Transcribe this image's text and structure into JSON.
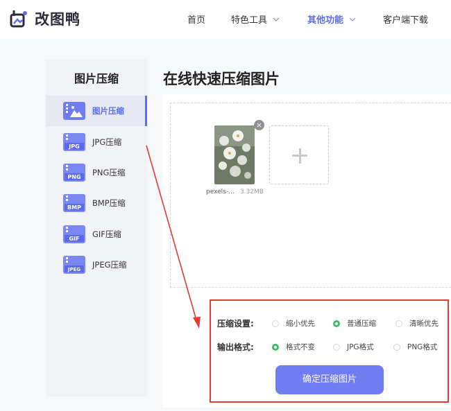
{
  "brand": {
    "name": "改图鸭",
    "color": "#5b6cf0"
  },
  "nav": [
    {
      "label": "首页",
      "dropdown": false,
      "active": false
    },
    {
      "label": "特色工具",
      "dropdown": true,
      "active": false
    },
    {
      "label": "其他功能",
      "dropdown": true,
      "active": true
    },
    {
      "label": "客户端下载",
      "dropdown": false,
      "active": false
    }
  ],
  "sidebar": {
    "title": "图片压缩",
    "items": [
      {
        "label": "图片压缩",
        "icon": "image-file-icon",
        "active": true
      },
      {
        "label": "JPG压缩",
        "icon": "JPG"
      },
      {
        "label": "PNG压缩",
        "icon": "PNG"
      },
      {
        "label": "BMP压缩",
        "icon": "BMP"
      },
      {
        "label": "GIF压缩",
        "icon": "GIF"
      },
      {
        "label": "JPEG压缩",
        "icon": "JPEG"
      }
    ]
  },
  "main": {
    "title": "在线快速压缩图片",
    "file": {
      "name": "pexels-...",
      "size": "3.32MB"
    }
  },
  "settings": {
    "compress_label": "压缩设置:",
    "compress_options": [
      {
        "label": "缩小优先",
        "selected": false
      },
      {
        "label": "普通压缩",
        "selected": true
      },
      {
        "label": "清晰优先",
        "selected": false
      }
    ],
    "format_label": "输出格式:",
    "format_options": [
      {
        "label": "格式不变",
        "selected": true
      },
      {
        "label": "JPG格式",
        "selected": false
      },
      {
        "label": "PNG格式",
        "selected": false
      }
    ],
    "confirm_label": "确定压缩图片"
  },
  "colors": {
    "accent": "#6f7cf2",
    "radio_on": "#3ebd6b",
    "highlight": "#e53935"
  }
}
